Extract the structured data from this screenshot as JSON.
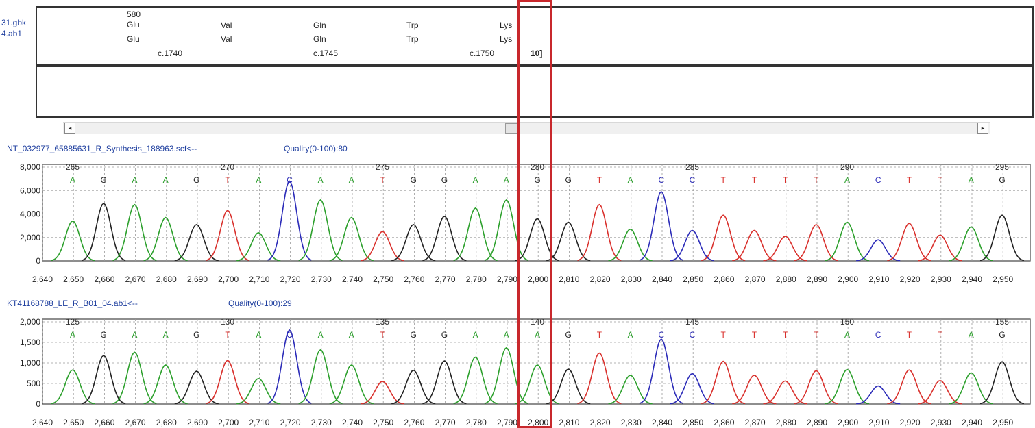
{
  "sequence_files": [
    "31.gbk",
    "4.ab1"
  ],
  "reference": {
    "start_position": "580",
    "rows": [
      [
        "Glu",
        "Val",
        "Gln",
        "Trp",
        "Lys"
      ],
      [
        "Glu",
        "Val",
        "Gln",
        "Trp",
        "Lys"
      ]
    ],
    "cdna_positions": [
      "c.1740",
      "c.1745",
      "c.1750"
    ],
    "marker": "10]"
  },
  "scroll": {
    "left_arrow": "◂",
    "right_arrow": "▸"
  },
  "colors": {
    "A": "#2ca02c",
    "G": "#222222",
    "C": "#2b2bb8",
    "T": "#d9302c",
    "highlight": "#c8282c"
  },
  "traces": [
    {
      "name": "NT_032977_65885631_R_Synthesis_188963.scf<--",
      "quality": "Quality(0-100):80",
      "bases": [
        "A",
        "G",
        "A",
        "A",
        "G",
        "T",
        "A",
        "C",
        "A",
        "A",
        "T",
        "G",
        "G",
        "A",
        "A",
        "G",
        "G",
        "T",
        "A",
        "C",
        "C",
        "T",
        "T",
        "T",
        "T",
        "A",
        "C",
        "T",
        "T",
        "A",
        "G"
      ],
      "peak_heights": [
        3400,
        4900,
        4800,
        3700,
        3100,
        4300,
        2400,
        6800,
        5200,
        3700,
        2500,
        3100,
        3800,
        4500,
        5200,
        3600,
        3300,
        4800,
        2700,
        5900,
        2600,
        3900,
        2600,
        2100,
        3100,
        3300,
        1800,
        3200,
        2200,
        2900,
        3900
      ],
      "base_numbers": [
        "265",
        "270",
        "275",
        "280",
        "285",
        "290",
        "295"
      ],
      "y_ticks": [
        "8,000",
        "6,000",
        "4,000",
        "2,000",
        "0"
      ],
      "y_max": 8000
    },
    {
      "name": "KT41168788_LE_R_B01_04.ab1<--",
      "quality": "Quality(0-100):29",
      "bases": [
        "A",
        "G",
        "A",
        "A",
        "G",
        "T",
        "A",
        "C",
        "A",
        "A",
        "T",
        "G",
        "G",
        "A",
        "A",
        "A",
        "G",
        "T",
        "A",
        "C",
        "C",
        "T",
        "T",
        "T",
        "T",
        "A",
        "C",
        "T",
        "T",
        "A",
        "G"
      ],
      "peak_heights": [
        830,
        1180,
        1260,
        950,
        800,
        1060,
        620,
        1800,
        1320,
        950,
        550,
        820,
        1050,
        1140,
        1370,
        950,
        850,
        1240,
        700,
        1580,
        740,
        1040,
        700,
        560,
        810,
        840,
        440,
        830,
        570,
        760,
        1030
      ],
      "base_numbers": [
        "125",
        "130",
        "135",
        "140",
        "145",
        "150",
        "155"
      ],
      "y_ticks": [
        "2,000",
        "1,500",
        "1,000",
        "500",
        "0"
      ],
      "y_max": 2000
    }
  ],
  "x_ticks": [
    "2,640",
    "2,650",
    "2,660",
    "2,670",
    "2,680",
    "2,690",
    "2,700",
    "2,710",
    "2,720",
    "2,730",
    "2,740",
    "2,750",
    "2,760",
    "2,770",
    "2,780",
    "2,790",
    "2,800",
    "2,810",
    "2,820",
    "2,830",
    "2,840",
    "2,850",
    "2,860",
    "2,870",
    "2,880",
    "2,890",
    "2,900",
    "2,910",
    "2,920",
    "2,930",
    "2,940",
    "2,950"
  ]
}
